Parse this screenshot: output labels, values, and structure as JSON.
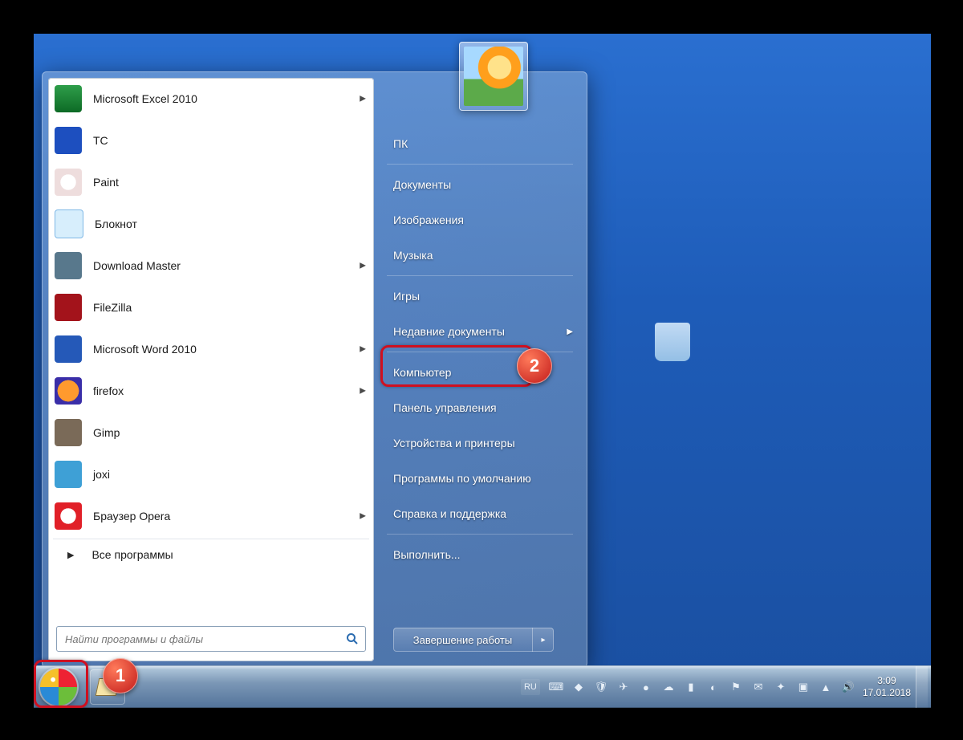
{
  "programs": [
    {
      "label": "Microsoft Excel 2010",
      "cls": "c-excel",
      "arrow": true
    },
    {
      "label": "TC",
      "cls": "c-tc",
      "arrow": false
    },
    {
      "label": "Paint",
      "cls": "c-paint",
      "arrow": false
    },
    {
      "label": "Блокнот",
      "cls": "c-np",
      "arrow": false
    },
    {
      "label": "Download Master",
      "cls": "c-dm",
      "arrow": true
    },
    {
      "label": "FileZilla",
      "cls": "c-fz",
      "arrow": false
    },
    {
      "label": "Microsoft Word 2010",
      "cls": "c-word",
      "arrow": true
    },
    {
      "label": "firefox",
      "cls": "c-ff",
      "arrow": true
    },
    {
      "label": "Gimp",
      "cls": "c-gimp",
      "arrow": false
    },
    {
      "label": "joxi",
      "cls": "c-joxi",
      "arrow": false
    },
    {
      "label": "Браузер Opera",
      "cls": "c-opera",
      "arrow": true
    }
  ],
  "all_programs": "Все программы",
  "search_placeholder": "Найти программы и файлы",
  "right": [
    {
      "label": "ПК",
      "arrow": false,
      "sep": false
    },
    {
      "label": "Документы",
      "arrow": false,
      "sep": true
    },
    {
      "label": "Изображения",
      "arrow": false,
      "sep": false
    },
    {
      "label": "Музыка",
      "arrow": false,
      "sep": false
    },
    {
      "label": "Игры",
      "arrow": false,
      "sep": true
    },
    {
      "label": "Недавние документы",
      "arrow": true,
      "sep": false
    },
    {
      "label": "Компьютер",
      "arrow": false,
      "sep": true
    },
    {
      "label": "Панель управления",
      "arrow": false,
      "sep": false
    },
    {
      "label": "Устройства и принтеры",
      "arrow": false,
      "sep": false
    },
    {
      "label": "Программы по умолчанию",
      "arrow": false,
      "sep": false
    },
    {
      "label": "Справка и поддержка",
      "arrow": false,
      "sep": false
    },
    {
      "label": "Выполнить...",
      "arrow": false,
      "sep": true
    }
  ],
  "shutdown": "Завершение работы",
  "recycle_bin": "",
  "lang": "RU",
  "clock_time": "3:09",
  "clock_date": "17.01.2018",
  "tray_icons": [
    "keyboard-icon",
    "app1-icon",
    "shield-icon",
    "telegram-icon",
    "vpn-icon",
    "cloud-icon",
    "network-icon",
    "status-icon",
    "flag-icon",
    "msg-icon",
    "tool-icon",
    "av-icon",
    "wifi-icon",
    "sound-icon"
  ],
  "callouts": {
    "1": "1",
    "2": "2"
  }
}
